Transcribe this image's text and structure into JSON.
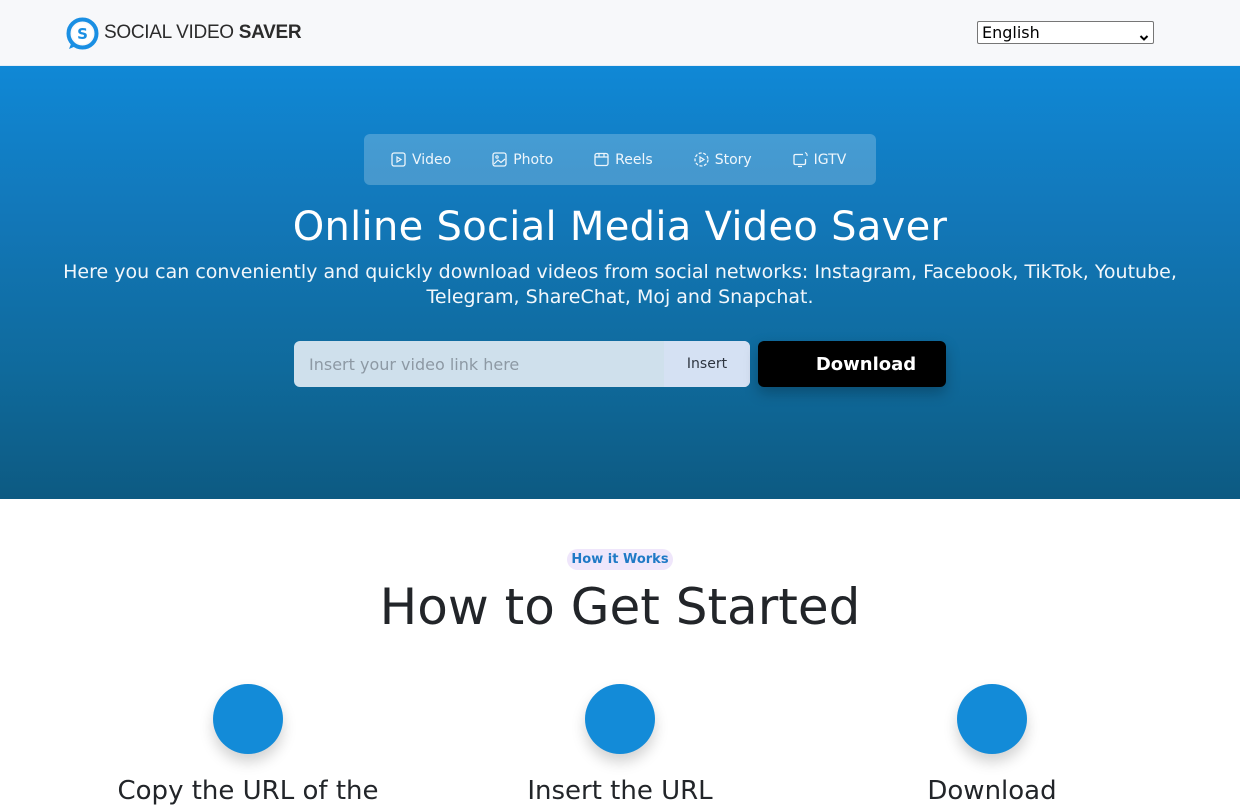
{
  "header": {
    "logo": {
      "text_light": "SOCIAL VIDEO ",
      "text_bold": "SAVER",
      "icon": "speech-bubble-s-icon"
    },
    "language_select": {
      "selected": "English",
      "icon": "chevron-down-icon"
    }
  },
  "hero": {
    "tabs": [
      {
        "label": "Video",
        "icon": "video-play-icon"
      },
      {
        "label": "Photo",
        "icon": "photo-icon"
      },
      {
        "label": "Reels",
        "icon": "reels-icon"
      },
      {
        "label": "Story",
        "icon": "story-icon"
      },
      {
        "label": "IGTV",
        "icon": "igtv-icon"
      }
    ],
    "title": "Online Social Media Video Saver",
    "subtitle_line1": "Here you can conveniently and quickly download videos from social networks: Instagram, Facebook, TikTok, Youtube,",
    "subtitle_line2": "Telegram, ShareChat, Moj and Snapchat.",
    "search": {
      "placeholder": "Insert your video link here",
      "value": "",
      "insert_label": "Insert"
    },
    "download_label": "Download"
  },
  "how_it_works": {
    "badge": "How it Works",
    "title": "How to Get Started",
    "steps": [
      {
        "title": "Copy the URL of the"
      },
      {
        "title": "Insert the URL"
      },
      {
        "title": "Download"
      }
    ]
  },
  "colors": {
    "brand_blue": "#138bd8",
    "hero_gradient_top": "#1088d6",
    "hero_gradient_bottom": "#0d5a82",
    "download_button": "#000000",
    "badge_bg": "#efe6fb",
    "badge_text": "#1f7ac6"
  }
}
